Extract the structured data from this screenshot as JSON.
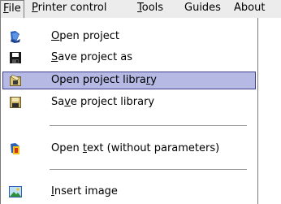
{
  "menubar": {
    "items": [
      {
        "label": "File",
        "mnemonic_index": 0
      },
      {
        "label": "Printer control",
        "mnemonic_index": 0
      },
      {
        "label": "Tools",
        "mnemonic_index": 0
      },
      {
        "label": "Guides",
        "mnemonic_index": -1
      },
      {
        "label": "About",
        "mnemonic_index": -1
      }
    ]
  },
  "file_menu": {
    "items": [
      {
        "label": "Open project",
        "mnemonic_index": 0,
        "icon": "open-folder-icon"
      },
      {
        "label": "Save project as",
        "mnemonic_index": 0,
        "icon": "floppy-disk-icon"
      },
      {
        "label": "Open project library",
        "mnemonic_index": 18,
        "icon": "open-library-icon",
        "selected": true
      },
      {
        "label": "Save project library",
        "mnemonic_index": 2,
        "icon": "save-library-icon"
      },
      {
        "label": "Open text (without parameters)",
        "mnemonic_index": 5,
        "icon": "open-text-icon"
      },
      {
        "label": "Insert image",
        "mnemonic_index": 0,
        "icon": "insert-image-icon"
      }
    ]
  },
  "colors": {
    "menubar_bg": "#ececec",
    "selection_bg": "#b5b9e3",
    "selection_border": "#3e3f8c"
  }
}
